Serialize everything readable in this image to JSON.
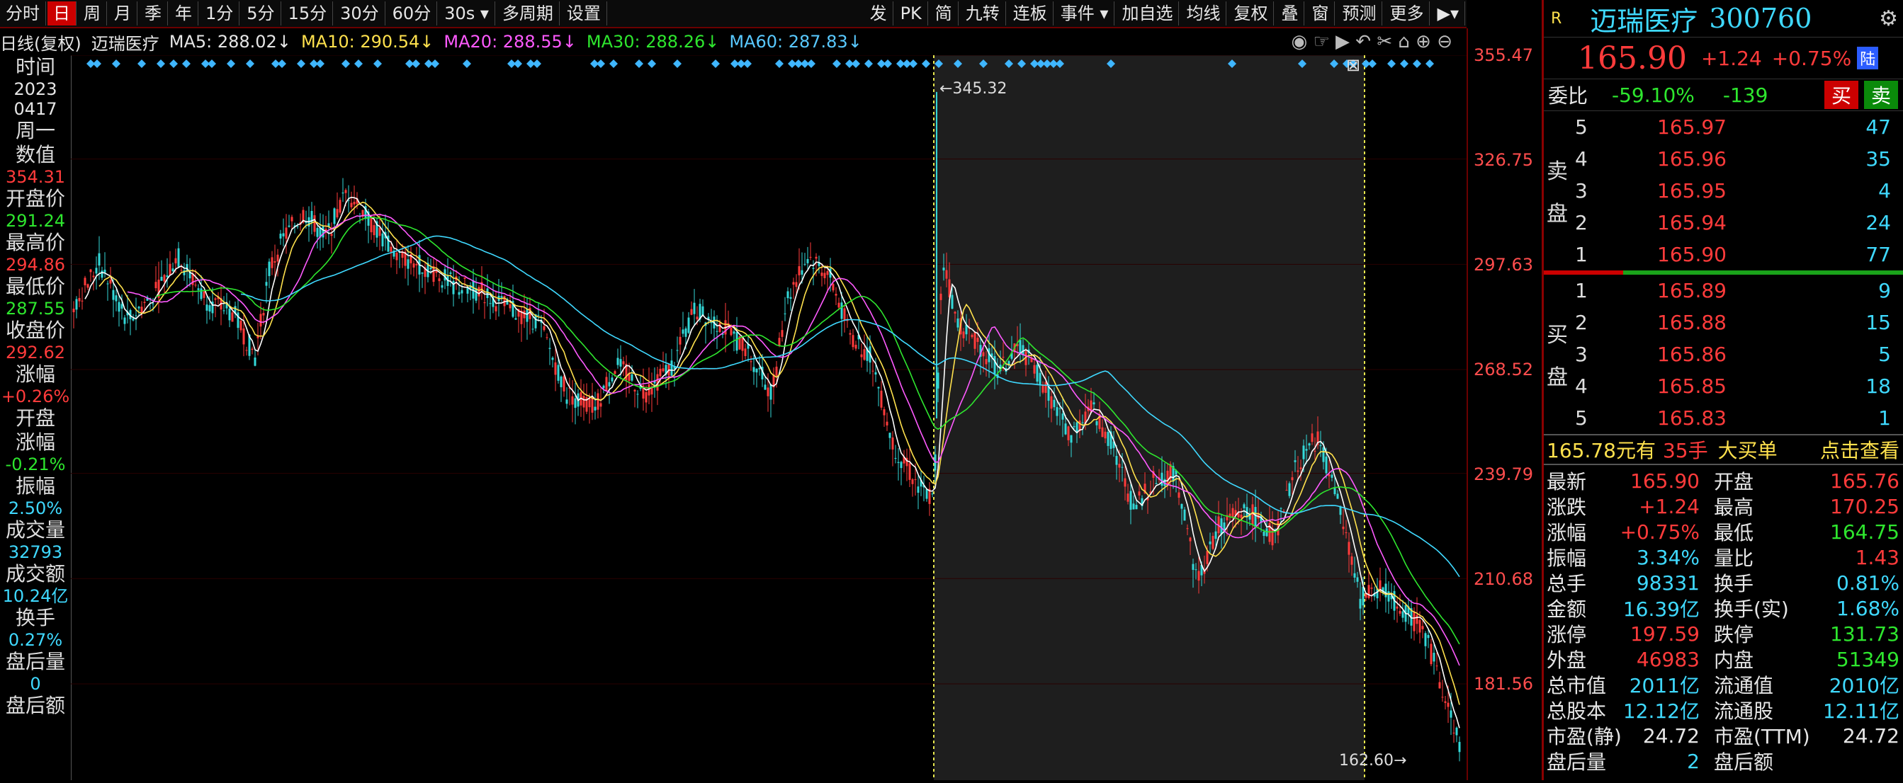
{
  "toolbar": {
    "left_buttons": [
      "分时",
      "日",
      "周",
      "月",
      "季",
      "年",
      "1分",
      "5分",
      "15分",
      "30分",
      "60分",
      "30s ▾",
      "多周期",
      "设置"
    ],
    "active": "日",
    "right_buttons": [
      "发",
      "PK",
      "简",
      "九转",
      "连板",
      "事件 ▾",
      "加自选",
      "均线",
      "复权",
      "叠",
      "窗",
      "预测",
      "更多",
      "▶▾"
    ]
  },
  "legend": {
    "period": "日线(复权)",
    "name": "迈瑞医疗",
    "ma5": "MA5: 288.02↓",
    "ma10": "MA10: 290.54↓",
    "ma20": "MA20: 288.55↓",
    "ma30": "MA30: 288.26↓",
    "ma60": "MA60: 287.83↓"
  },
  "left_panel": [
    {
      "label": "时间",
      "value": "2023",
      "vcolor": "white"
    },
    {
      "label": "",
      "value": "0417",
      "vcolor": "white"
    },
    {
      "label": "周一",
      "value": "",
      "vcolor": "white"
    },
    {
      "label": "数值",
      "value": "354.31",
      "vcolor": "red"
    },
    {
      "label": "开盘价",
      "value": "291.24",
      "vcolor": "green"
    },
    {
      "label": "最高价",
      "value": "294.86",
      "vcolor": "red"
    },
    {
      "label": "最低价",
      "value": "287.55",
      "vcolor": "green"
    },
    {
      "label": "收盘价",
      "value": "292.62",
      "vcolor": "red"
    },
    {
      "label": "涨幅",
      "value": "+0.26%",
      "vcolor": "red"
    },
    {
      "label": "开盘",
      "value": "",
      "vcolor": "white"
    },
    {
      "label": "涨幅",
      "value": "-0.21%",
      "vcolor": "green"
    },
    {
      "label": "振幅",
      "value": "2.50%",
      "vcolor": "cyan"
    },
    {
      "label": "成交量",
      "value": "32793",
      "vcolor": "cyan"
    },
    {
      "label": "成交额",
      "value": "10.24亿",
      "vcolor": "cyan"
    },
    {
      "label": "换手",
      "value": "0.27%",
      "vcolor": "cyan"
    },
    {
      "label": "盘后量",
      "value": "0",
      "vcolor": "cyan"
    },
    {
      "label": "盘后额",
      "value": "",
      "vcolor": "white"
    }
  ],
  "yaxis": [
    "355.47",
    "326.75",
    "297.63",
    "268.52",
    "239.79",
    "210.68",
    "181.56"
  ],
  "annotations": {
    "high": "345.32",
    "low": "162.60"
  },
  "colors": {
    "up": "#ff3b3b",
    "down": "#33d9d9",
    "ma5": "#ffffff",
    "ma10": "#ffe14d",
    "ma20": "#ff5aff",
    "ma30": "#2ee62e",
    "ma60": "#3fd9ff",
    "highlight": "#1e1e1e"
  },
  "quote": {
    "badge": "R",
    "name": "迈瑞医疗",
    "code": "300760",
    "price": "165.90",
    "change": "+1.24",
    "pct": "+0.75%",
    "tag": "陆",
    "weibi_label": "委比",
    "weibi": "-59.10%",
    "weicha": "-139",
    "buy_btn": "买",
    "sell_btn": "卖",
    "asks": [
      {
        "idx": "5",
        "price": "165.97",
        "vol": "47"
      },
      {
        "idx": "4",
        "price": "165.96",
        "vol": "35"
      },
      {
        "idx": "3",
        "price": "165.95",
        "vol": "4"
      },
      {
        "idx": "2",
        "price": "165.94",
        "vol": "24"
      },
      {
        "idx": "1",
        "price": "165.90",
        "vol": "77"
      }
    ],
    "bids": [
      {
        "idx": "1",
        "price": "165.89",
        "vol": "9"
      },
      {
        "idx": "2",
        "price": "165.88",
        "vol": "15"
      },
      {
        "idx": "3",
        "price": "165.86",
        "vol": "5"
      },
      {
        "idx": "4",
        "price": "165.85",
        "vol": "18"
      },
      {
        "idx": "5",
        "price": "165.83",
        "vol": "1"
      }
    ],
    "ask_label": [
      "卖",
      "盘"
    ],
    "bid_label": [
      "买",
      "盘"
    ],
    "big_order": {
      "price": "165.78元有",
      "count": "35手",
      "text": "大买单",
      "link": "点击查看"
    },
    "stats": [
      [
        "最新",
        "165.90",
        "red",
        "开盘",
        "165.76",
        "red"
      ],
      [
        "涨跌",
        "+1.24",
        "red",
        "最高",
        "170.25",
        "red"
      ],
      [
        "涨幅",
        "+0.75%",
        "red",
        "最低",
        "164.75",
        "green"
      ],
      [
        "振幅",
        "3.34%",
        "cyan",
        "量比",
        "1.43",
        "red"
      ],
      [
        "总手",
        "98331",
        "cyan",
        "换手",
        "0.81%",
        "cyan"
      ],
      [
        "金额",
        "16.39亿",
        "cyan",
        "换手(实)",
        "1.68%",
        "cyan"
      ],
      [
        "涨停",
        "197.59",
        "red",
        "跌停",
        "131.73",
        "green"
      ],
      [
        "外盘",
        "46983",
        "red",
        "内盘",
        "51349",
        "green"
      ],
      [
        "总市值",
        "2011亿",
        "cyan",
        "流通值",
        "2010亿",
        "cyan"
      ],
      [
        "总股本",
        "12.12亿",
        "cyan",
        "流通股",
        "12.11亿",
        "cyan"
      ],
      [
        "市盈(静)",
        "24.72",
        "white",
        "市盈(TTM)",
        "24.72",
        "white"
      ],
      [
        "盘后量",
        "2",
        "cyan",
        "盘后额",
        "",
        "white"
      ]
    ]
  }
}
